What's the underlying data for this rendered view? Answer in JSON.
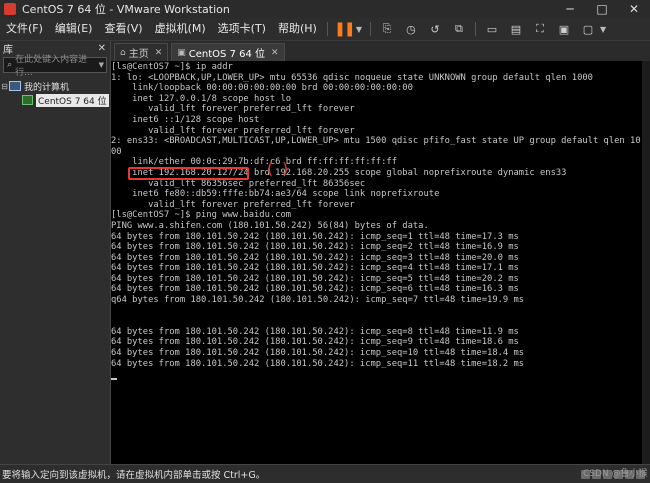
{
  "window": {
    "title": "CentOS 7 64 位 - VMware Workstation"
  },
  "menu": {
    "items": [
      "文件(F)",
      "编辑(E)",
      "查看(V)",
      "虚拟机(M)",
      "选项卡(T)",
      "帮助(H)"
    ]
  },
  "sidebar": {
    "title": "库",
    "search_placeholder": "在此处键入内容进行...",
    "tree": {
      "root_label": "我的计算机",
      "child_label": "CentOS 7 64 位"
    }
  },
  "tabs": [
    {
      "label": "主页",
      "icon": "home-icon"
    },
    {
      "label": "CentOS 7 64 位",
      "icon": "vm-icon"
    }
  ],
  "terminal": {
    "lines": [
      "[ls@CentOS7 ~]$ ip addr",
      "1: lo: <LOOPBACK,UP,LOWER_UP> mtu 65536 qdisc noqueue state UNKNOWN group default qlen 1000",
      "    link/loopback 00:00:00:00:00:00 brd 00:00:00:00:00:00",
      "    inet 127.0.0.1/8 scope host lo",
      "       valid_lft forever preferred_lft forever",
      "    inet6 ::1/128 scope host",
      "       valid_lft forever preferred_lft forever",
      "2: ens33: <BROADCAST,MULTICAST,UP,LOWER_UP> mtu 1500 qdisc pfifo_fast state UP group default qlen 10",
      "00",
      "    link/ether 00:0c:29:7b:df:c6 brd ff:ff:ff:ff:ff:ff",
      "    inet 192.168.20.127/24 brd 192.168.20.255 scope global noprefixroute dynamic ens33",
      "       valid_lft 86356sec preferred_lft 86356sec",
      "    inet6 fe80::db59:fffe:bb74:ae3/64 scope link noprefixroute",
      "       valid_lft forever preferred_lft forever",
      "[ls@CentOS7 ~]$ ping www.baidu.com",
      "PING www.a.shifen.com (180.101.50.242) 56(84) bytes of data.",
      "64 bytes from 180.101.50.242 (180.101.50.242): icmp_seq=1 ttl=48 time=17.3 ms",
      "64 bytes from 180.101.50.242 (180.101.50.242): icmp_seq=2 ttl=48 time=16.9 ms",
      "64 bytes from 180.101.50.242 (180.101.50.242): icmp_seq=3 ttl=48 time=20.0 ms",
      "64 bytes from 180.101.50.242 (180.101.50.242): icmp_seq=4 ttl=48 time=17.1 ms",
      "64 bytes from 180.101.50.242 (180.101.50.242): icmp_seq=5 ttl=48 time=20.2 ms",
      "64 bytes from 180.101.50.242 (180.101.50.242): icmp_seq=6 ttl=48 time=16.3 ms",
      "q64 bytes from 180.101.50.242 (180.101.50.242): icmp_seq=7 ttl=48 time=19.9 ms",
      "",
      "",
      "64 bytes from 180.101.50.242 (180.101.50.242): icmp_seq=8 ttl=48 time=11.9 ms",
      "64 bytes from 180.101.50.242 (180.101.50.242): icmp_seq=9 ttl=48 time=18.6 ms",
      "64 bytes from 180.101.50.242 (180.101.50.242): icmp_seq=10 ttl=48 time=18.4 ms",
      "64 bytes from 180.101.50.242 (180.101.50.242): icmp_seq=11 ttl=48 time=18.2 ms"
    ]
  },
  "statusbar": {
    "text": "要将输入定向到该虚拟机，请在虚拟机内部单击或按 Ctrl+G。",
    "watermark": "CSDN @鲁小猴"
  },
  "colors": {
    "accent_pause": "#ff7a1a",
    "annotation_red": "#e53935"
  }
}
